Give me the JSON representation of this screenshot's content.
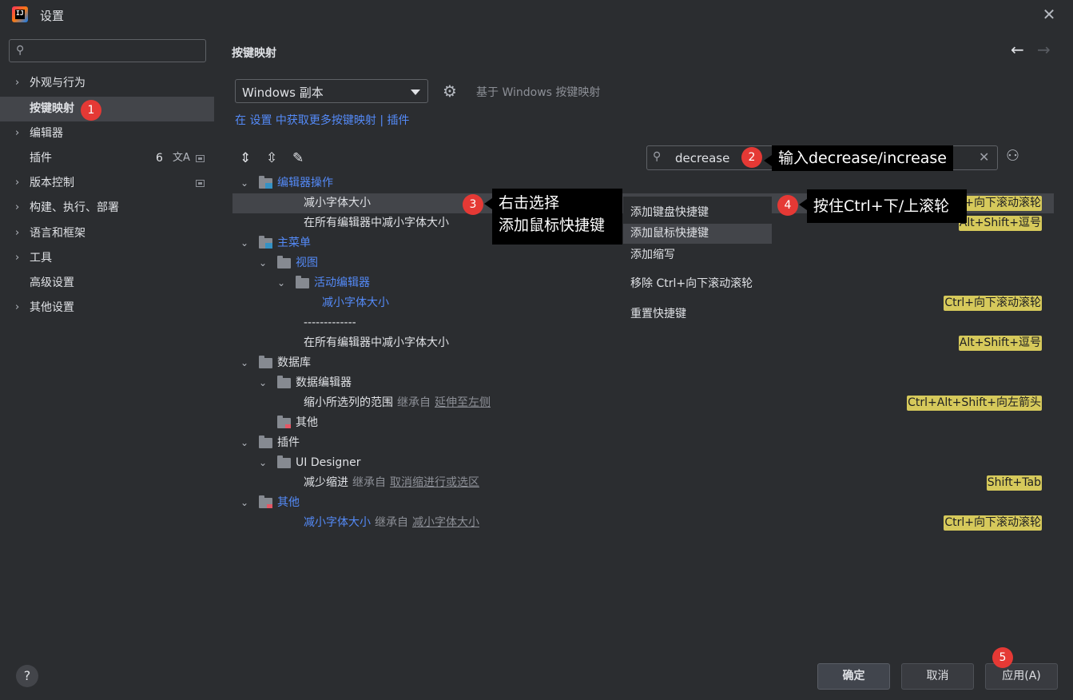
{
  "window": {
    "title": "设置",
    "close_glyph": "✕",
    "logo_text": "IJ"
  },
  "sidebar": {
    "search_placeholder": "",
    "items": [
      {
        "label": "外观与行为",
        "chevron": "›",
        "selected": false
      },
      {
        "label": "按键映射",
        "selected": true
      },
      {
        "label": "编辑器",
        "chevron": "›",
        "selected": false
      },
      {
        "label": "插件",
        "count": "6",
        "selected": false
      },
      {
        "label": "版本控制",
        "chevron": "›",
        "selected": false
      },
      {
        "label": "构建、执行、部署",
        "chevron": "›",
        "selected": false
      },
      {
        "label": "语言和框架",
        "chevron": "›",
        "selected": false
      },
      {
        "label": "工具",
        "chevron": "›",
        "selected": false
      },
      {
        "label": "高级设置",
        "selected": false
      },
      {
        "label": "其他设置",
        "chevron": "›",
        "selected": false
      }
    ]
  },
  "main": {
    "title": "按键映射",
    "nav_back": "←",
    "nav_forward": "→",
    "keymap_value": "Windows 副本",
    "based_on": "基于 Windows 按键映射",
    "get_more_link": "在 设置 中获取更多按键映射 | 插件",
    "search_value": "decrease",
    "tree": [
      {
        "label": "编辑器操作",
        "level": 0,
        "expanded": true,
        "folder": "special",
        "blue": true
      },
      {
        "label": "减小字体大小",
        "level": 1,
        "selected": true,
        "shortcut": "Ctrl+向下滚动滚轮"
      },
      {
        "label": "在所有编辑器中减小字体大小",
        "level": 1,
        "shortcut": "Alt+Shift+逗号"
      },
      {
        "label": "主菜单",
        "level": 0,
        "expanded": true,
        "folder": "special",
        "blue": true
      },
      {
        "label": "视图",
        "level": 1,
        "expanded": true,
        "folder": "plain",
        "blue": true
      },
      {
        "label": "活动编辑器",
        "level": 2,
        "expanded": true,
        "folder": "plain",
        "blue": true
      },
      {
        "label": "减小字体大小",
        "level": 3,
        "blue": true,
        "shortcut": "Ctrl+向下滚动滚轮"
      },
      {
        "label": "-------------",
        "level": 2
      },
      {
        "label": "在所有编辑器中减小字体大小",
        "level": 2,
        "shortcut": "Alt+Shift+逗号"
      },
      {
        "label": "数据库",
        "level": 0,
        "expanded": true,
        "folder": "plain"
      },
      {
        "label": "数据编辑器",
        "level": 1,
        "expanded": true,
        "folder": "plain"
      },
      {
        "label": "缩小所选列的范围",
        "level": 2,
        "inherit": "继承自",
        "inherit_link": "延伸至左侧",
        "shortcut": "Ctrl+Alt+Shift+向左箭头"
      },
      {
        "label": "其他",
        "level": 1,
        "folder": "red"
      },
      {
        "label": "插件",
        "level": 0,
        "expanded": true,
        "folder": "plain"
      },
      {
        "label": "UI Designer",
        "level": 1,
        "expanded": true,
        "folder": "plain"
      },
      {
        "label": "减少缩进",
        "level": 2,
        "inherit": "继承自",
        "inherit_link": "取消缩进行或选区",
        "shortcut": "Shift+Tab"
      },
      {
        "label": "其他",
        "level": 0,
        "expanded": true,
        "folder": "red",
        "blue": true
      },
      {
        "label": "减小字体大小",
        "level": 1,
        "blue": true,
        "inherit": "继承自",
        "inherit_link": "减小字体大小",
        "shortcut": "Ctrl+向下滚动滚轮"
      }
    ]
  },
  "context_menu": {
    "items": [
      {
        "label": "添加键盘快捷键",
        "selected": false
      },
      {
        "label": "添加鼠标快捷键",
        "selected": true
      },
      {
        "label": "添加缩写",
        "selected": false
      },
      {
        "label": "移除 Ctrl+向下滚动滚轮",
        "selected": false
      },
      {
        "label": "重置快捷键",
        "selected": false
      }
    ]
  },
  "annotations": {
    "b1": "1",
    "b2": "2",
    "b3": "3",
    "b4": "4",
    "b5": "5",
    "c2": "输入decrease/increase",
    "c3_line1": "右击选择",
    "c3_line2": "添加鼠标快捷键",
    "c4": "按住Ctrl+下/上滚轮"
  },
  "footer": {
    "help": "?",
    "ok": "确定",
    "cancel": "取消",
    "apply": "应用(A)"
  },
  "colors": {
    "background": "#2b2d30",
    "selection": "#43454a",
    "link": "#548af7",
    "shortcut_bg": "#d6c95b",
    "badge": "#e53935"
  }
}
